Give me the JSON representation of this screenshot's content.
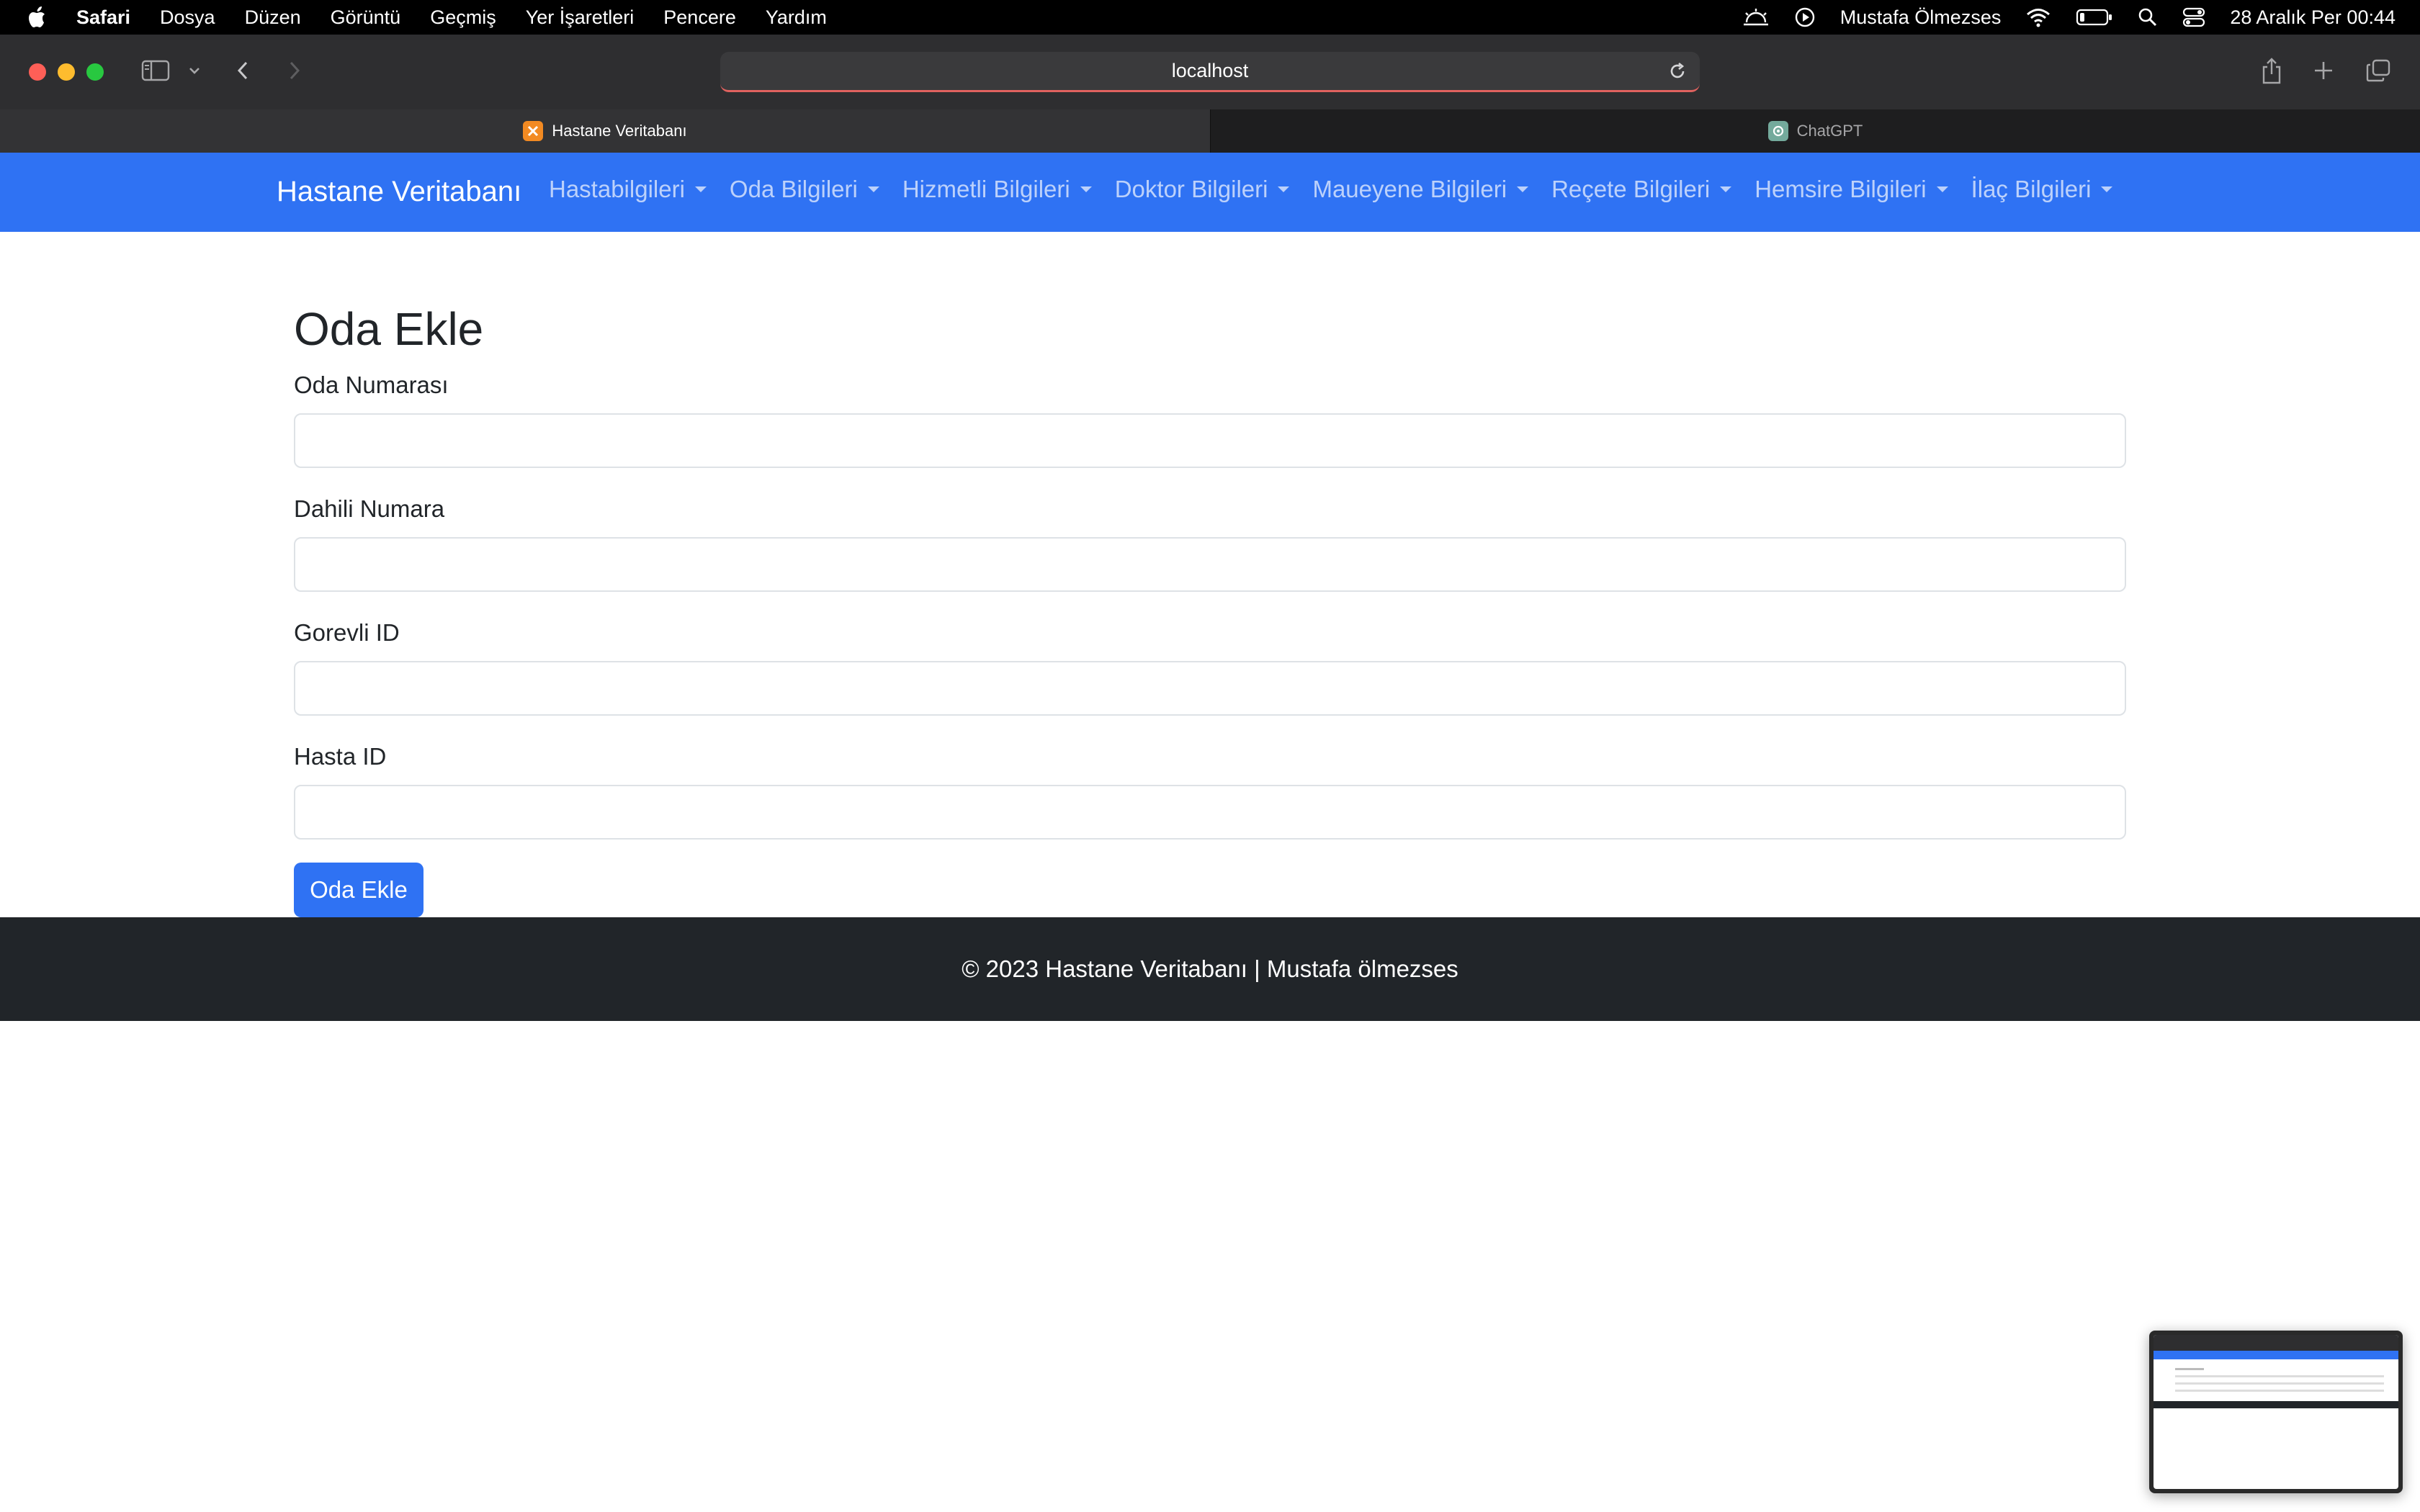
{
  "menubar": {
    "app_name": "Safari",
    "items": [
      "Dosya",
      "Düzen",
      "Görüntü",
      "Geçmiş",
      "Yer İşaretleri",
      "Pencere",
      "Yardım"
    ],
    "user_name": "Mustafa Ölmezses",
    "datetime": "28 Aralık Per  00:44"
  },
  "browser": {
    "url": "localhost",
    "tabs": [
      {
        "label": "Hastane Veritabanı",
        "active": true
      },
      {
        "label": "ChatGPT",
        "active": false
      }
    ]
  },
  "navbar": {
    "brand": "Hastane Veritabanı",
    "items": [
      "Hastabilgileri",
      "Oda Bilgileri",
      "Hizmetli Bilgileri",
      "Doktor Bilgileri",
      "Maueyene Bilgileri",
      "Reçete Bilgileri",
      "Hemsire Bilgileri",
      "İlaç Bilgileri"
    ]
  },
  "form": {
    "title": "Oda Ekle",
    "fields": [
      {
        "label": "Oda Numarası",
        "value": ""
      },
      {
        "label": "Dahili Numara",
        "value": ""
      },
      {
        "label": "Gorevli ID",
        "value": ""
      },
      {
        "label": "Hasta ID",
        "value": ""
      }
    ],
    "submit_label": "Oda Ekle"
  },
  "footer": {
    "text": "© 2023 Hastane Veritabanı | Mustafa ölmezses"
  },
  "colors": {
    "navbar": "#2f72f3",
    "footer": "#212529",
    "button": "#2f72f3"
  }
}
